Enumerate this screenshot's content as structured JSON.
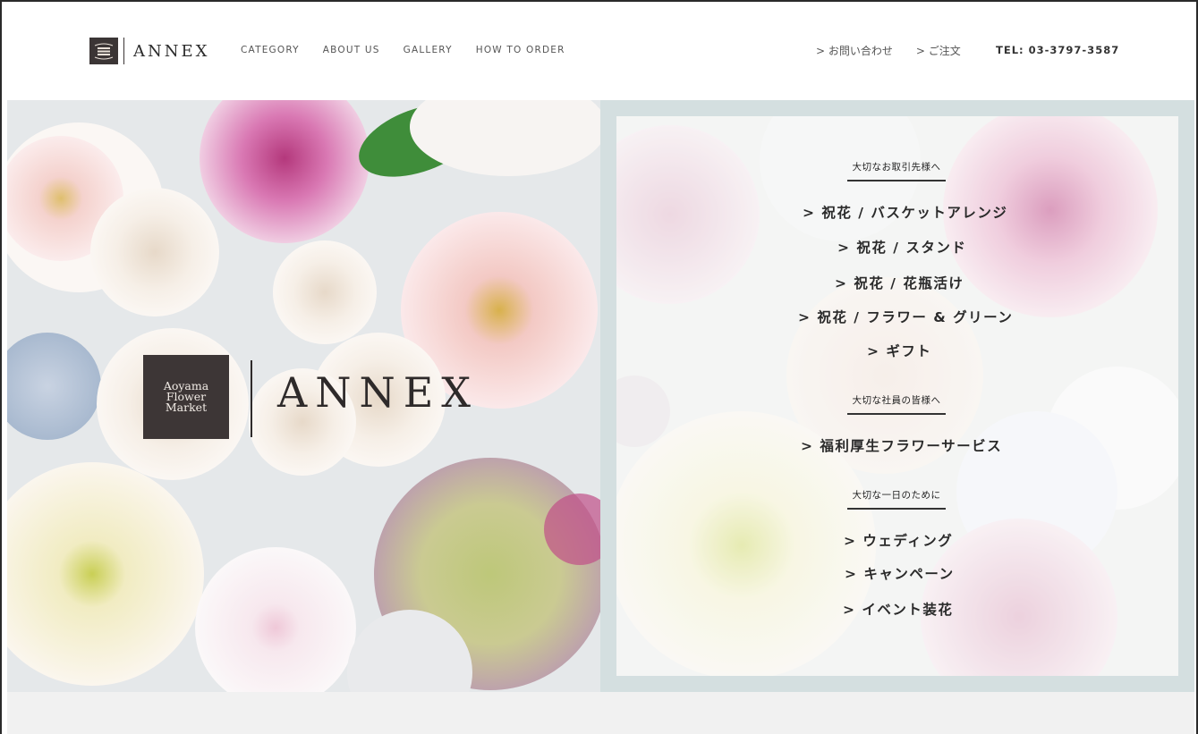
{
  "header": {
    "brand_text": "ANNEX",
    "nav": [
      "CATEGORY",
      "ABOUT US",
      "GALLERY",
      "HOW TO ORDER"
    ],
    "contact_link": "> お問い合わせ",
    "order_link": "> ご注文",
    "tel": "TEL: 03-3797-3587"
  },
  "hero": {
    "logo_lines": [
      "Aoyama",
      "Flower",
      "Market"
    ],
    "logo_word": "ANNEX"
  },
  "menu": {
    "sections": [
      {
        "title": "大切なお取引先様へ",
        "links": [
          "> 祝花 / バスケットアレンジ",
          "> 祝花 / スタンド",
          "> 祝花 / 花瓶活け",
          "> 祝花 / フラワー & グリーン",
          "> ギフト"
        ]
      },
      {
        "title": "大切な社員の皆様へ",
        "links": [
          "> 福利厚生フラワーサービス"
        ]
      },
      {
        "title": "大切な一日のために",
        "links": [
          "> ウェディング",
          "> キャンペーン",
          "> イベント装花"
        ]
      }
    ]
  },
  "colors": {
    "brand_dark": "#3d3636",
    "right_panel_bg": "#d4dfe0",
    "footer_bg": "#f1f1f1"
  }
}
